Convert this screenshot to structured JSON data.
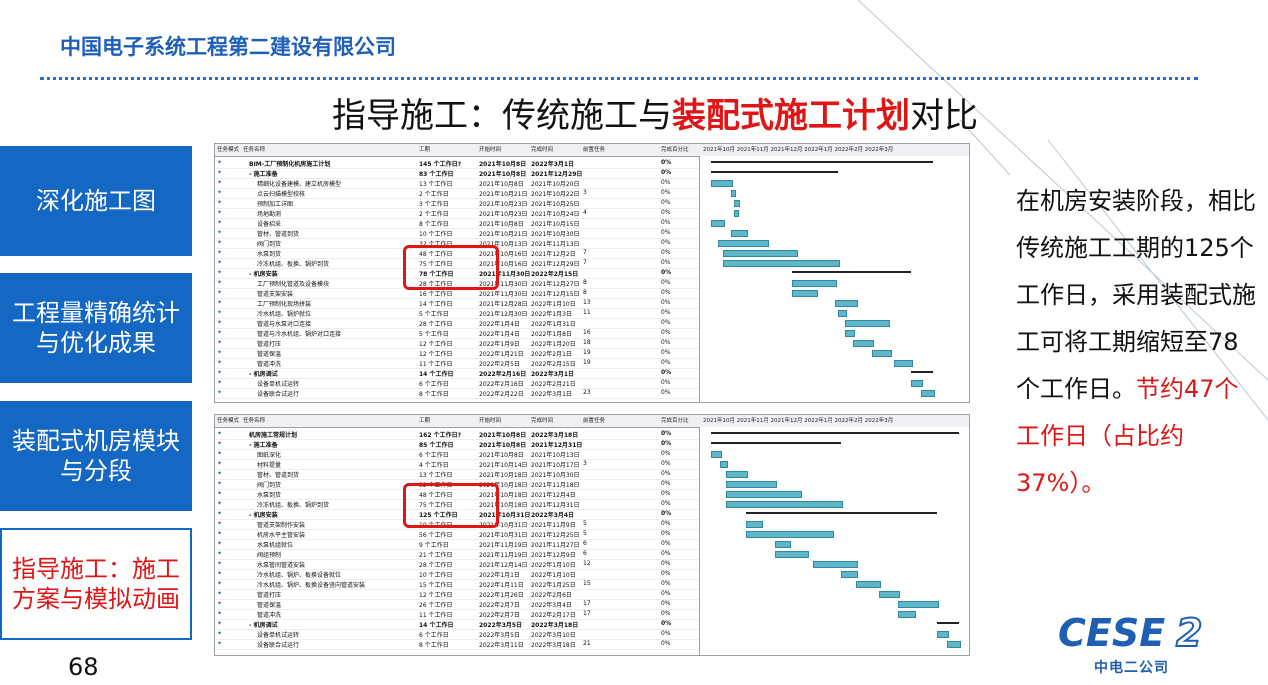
{
  "header": {
    "company": "中国电子系统工程第二建设有限公司",
    "title_prefix": "指导施工：传统施工与",
    "title_highlight": "装配式施工计划",
    "title_suffix": "对比"
  },
  "sidebar": {
    "items": [
      {
        "label": "深化施工图"
      },
      {
        "label": "工程量精确统计与优化成果"
      },
      {
        "label": "装配式机房模块与分段"
      },
      {
        "label": "指导施工：施工方案与模拟动画"
      }
    ]
  },
  "description": {
    "lead": "在机房安装阶段，相比传统施工工期的125个工作日，采用装配式施工可将工期缩短至78个工作日。",
    "saving": "节约47个工作日（占比约37%）。"
  },
  "page_number": "68",
  "logo": {
    "text": "CESE2",
    "sub": "中电二公司"
  },
  "colors": {
    "accent_blue": "#1567c4",
    "highlight_red": "#e01515",
    "bar_color": "#5fb6c9"
  },
  "gantt_columns": [
    "任务模式",
    "任务名称",
    "工期",
    "开始时间",
    "完成时间",
    "前置任务",
    "完成百分比"
  ],
  "gantt_top": {
    "timeline_label": "2021年10月 2021年11月 2021年12月 2022年1月 2022年2月 2022年3月",
    "rows": [
      {
        "name": "BIM-工厂预制化机房施工计划",
        "dur": "145 个工作日?",
        "start": "2021年10月8日",
        "end": "2022年3月1日",
        "pred": "",
        "pct": "0%",
        "sum": true
      },
      {
        "name": "- 施工准备",
        "dur": "83 个工作日",
        "start": "2021年10月8日",
        "end": "2021年12月29日",
        "pred": "",
        "pct": "0%",
        "sum": true
      },
      {
        "name": "精细化设备建模、建立机房模型",
        "dur": "13 个工作日",
        "start": "2021年10月8日",
        "end": "2021年10月20日",
        "pred": "",
        "pct": "0%"
      },
      {
        "name": "点云扫描模型校核",
        "dur": "2 个工作日",
        "start": "2021年10月21日",
        "end": "2021年10月22日",
        "pred": "3",
        "pct": "0%"
      },
      {
        "name": "预制加工详图",
        "dur": "3 个工作日",
        "start": "2021年10月23日",
        "end": "2021年10月25日",
        "pred": "",
        "pct": "0%"
      },
      {
        "name": "场地勘测",
        "dur": "2 个工作日",
        "start": "2021年10月23日",
        "end": "2021年10月24日",
        "pred": "4",
        "pct": "0%"
      },
      {
        "name": "设备招采",
        "dur": "8 个工作日",
        "start": "2021年10月8日",
        "end": "2021年10月15日",
        "pred": "",
        "pct": "0%"
      },
      {
        "name": "管材、管道到货",
        "dur": "10 个工作日",
        "start": "2021年10月21日",
        "end": "2021年10月30日",
        "pred": "",
        "pct": "0%"
      },
      {
        "name": "阀门到货",
        "dur": "32 个工作日",
        "start": "2021年10月13日",
        "end": "2021年11月13日",
        "pred": "",
        "pct": "0%"
      },
      {
        "name": "水泵到货",
        "dur": "48 个工作日",
        "start": "2021年10月16日",
        "end": "2021年12月2日",
        "pred": "7",
        "pct": "0%"
      },
      {
        "name": "冷冻机组、板换、锅炉到货",
        "dur": "75 个工作日",
        "start": "2021年10月16日",
        "end": "2021年12月29日",
        "pred": "7",
        "pct": "0%"
      },
      {
        "name": "- 机房安装",
        "dur": "78 个工作日",
        "start": "2021年11月30日",
        "end": "2022年2月15日",
        "pred": "",
        "pct": "0%",
        "sum": true
      },
      {
        "name": "工厂预制化管道及设备模块",
        "dur": "28 个工作日",
        "start": "2021年11月30日",
        "end": "2021年12月27日",
        "pred": "8",
        "pct": "0%"
      },
      {
        "name": "管道支架安装",
        "dur": "16 个工作日",
        "start": "2021年11月30日",
        "end": "2021年12月15日",
        "pred": "8",
        "pct": "0%"
      },
      {
        "name": "工厂预制化现场拼装",
        "dur": "14 个工作日",
        "start": "2021年12月28日",
        "end": "2022年1月10日",
        "pred": "13",
        "pct": "0%"
      },
      {
        "name": "冷水机组、锅炉就位",
        "dur": "5 个工作日",
        "start": "2021年12月30日",
        "end": "2022年1月3日",
        "pred": "11",
        "pct": "0%"
      },
      {
        "name": "管道与水泵对口连接",
        "dur": "28 个工作日",
        "start": "2022年1月4日",
        "end": "2022年1月31日",
        "pred": "",
        "pct": "0%"
      },
      {
        "name": "管道与冷水机组、锅炉对口连接",
        "dur": "5 个工作日",
        "start": "2022年1月4日",
        "end": "2022年1月8日",
        "pred": "16",
        "pct": "0%"
      },
      {
        "name": "管道打压",
        "dur": "12 个工作日",
        "start": "2022年1月9日",
        "end": "2022年1月20日",
        "pred": "18",
        "pct": "0%"
      },
      {
        "name": "管道保温",
        "dur": "12 个工作日",
        "start": "2022年1月21日",
        "end": "2022年2月1日",
        "pred": "19",
        "pct": "0%"
      },
      {
        "name": "管道冲洗",
        "dur": "11 个工作日",
        "start": "2022年2月5日",
        "end": "2022年2月15日",
        "pred": "19",
        "pct": "0%"
      },
      {
        "name": "- 机房调试",
        "dur": "14 个工作日",
        "start": "2022年2月16日",
        "end": "2022年3月1日",
        "pred": "",
        "pct": "0%",
        "sum": true
      },
      {
        "name": "设备单机试运转",
        "dur": "6 个工作日",
        "start": "2022年2月16日",
        "end": "2022年2月21日",
        "pred": "",
        "pct": "0%"
      },
      {
        "name": "设备联合试运行",
        "dur": "8 个工作日",
        "start": "2022年2月22日",
        "end": "2022年3月1日",
        "pred": "23",
        "pct": "0%"
      }
    ]
  },
  "gantt_bottom": {
    "timeline_label": "2021年10月 2021年11月 2021年12月 2022年1月 2022年2月 2022年3月",
    "rows": [
      {
        "name": "机房施工常规计划",
        "dur": "162 个工作日?",
        "start": "2021年10月8日",
        "end": "2022年3月18日",
        "pred": "",
        "pct": "0%",
        "sum": true
      },
      {
        "name": "- 施工准备",
        "dur": "85 个工作日",
        "start": "2021年10月8日",
        "end": "2021年12月31日",
        "pred": "",
        "pct": "0%",
        "sum": true
      },
      {
        "name": "图纸深化",
        "dur": "6 个工作日",
        "start": "2021年10月8日",
        "end": "2021年10月13日",
        "pred": "",
        "pct": "0%"
      },
      {
        "name": "材料提量",
        "dur": "4 个工作日",
        "start": "2021年10月14日",
        "end": "2021年10月17日",
        "pred": "3",
        "pct": "0%"
      },
      {
        "name": "管材、管道到货",
        "dur": "13 个工作日",
        "start": "2021年10月18日",
        "end": "2021年10月30日",
        "pred": "",
        "pct": "0%"
      },
      {
        "name": "阀门到货",
        "dur": "32 个工作日",
        "start": "2021年10月18日",
        "end": "2021年11月18日",
        "pred": "",
        "pct": "0%"
      },
      {
        "name": "水泵到货",
        "dur": "48 个工作日",
        "start": "2021年10月18日",
        "end": "2021年12月4日",
        "pred": "",
        "pct": "0%"
      },
      {
        "name": "冷冻机组、板换、锅炉到货",
        "dur": "75 个工作日",
        "start": "2021年10月18日",
        "end": "2021年12月31日",
        "pred": "",
        "pct": "0%"
      },
      {
        "name": "- 机房安装",
        "dur": "125 个工作日",
        "start": "2021年10月31日",
        "end": "2022年3月4日",
        "pred": "",
        "pct": "0%",
        "sum": true
      },
      {
        "name": "管道支架制作安装",
        "dur": "10 个工作日",
        "start": "2021年10月31日",
        "end": "2021年11月9日",
        "pred": "5",
        "pct": "0%"
      },
      {
        "name": "机房水平主管安装",
        "dur": "56 个工作日",
        "start": "2021年10月31日",
        "end": "2021年12月25日",
        "pred": "5",
        "pct": "0%"
      },
      {
        "name": "水泵机组就位",
        "dur": "9 个工作日",
        "start": "2021年11月19日",
        "end": "2021年11月27日",
        "pred": "6",
        "pct": "0%"
      },
      {
        "name": "阀组预制",
        "dur": "21 个工作日",
        "start": "2021年11月19日",
        "end": "2021年12月9日",
        "pred": "6",
        "pct": "0%"
      },
      {
        "name": "水泵管间管道安装",
        "dur": "28 个工作日",
        "start": "2021年12月14日",
        "end": "2022年1月10日",
        "pred": "12",
        "pct": "0%"
      },
      {
        "name": "冷水机组、锅炉、板换设备就位",
        "dur": "10 个工作日",
        "start": "2022年1月1日",
        "end": "2022年1月10日",
        "pred": "",
        "pct": "0%"
      },
      {
        "name": "冷水机组、锅炉、板换设备竖向管道安装",
        "dur": "15 个工作日",
        "start": "2022年1月11日",
        "end": "2022年1月25日",
        "pred": "15",
        "pct": "0%"
      },
      {
        "name": "管道打压",
        "dur": "12 个工作日",
        "start": "2022年1月26日",
        "end": "2022年2月6日",
        "pred": "",
        "pct": "0%"
      },
      {
        "name": "管道保温",
        "dur": "26 个工作日",
        "start": "2022年2月7日",
        "end": "2022年3月4日",
        "pred": "17",
        "pct": "0%"
      },
      {
        "name": "管道冲洗",
        "dur": "11 个工作日",
        "start": "2022年2月7日",
        "end": "2022年2月17日",
        "pred": "17",
        "pct": "0%"
      },
      {
        "name": "- 机房调试",
        "dur": "14 个工作日",
        "start": "2022年3月5日",
        "end": "2022年3月18日",
        "pred": "",
        "pct": "0%",
        "sum": true
      },
      {
        "name": "设备单机试运转",
        "dur": "6 个工作日",
        "start": "2022年3月5日",
        "end": "2022年3月10日",
        "pred": "",
        "pct": "0%"
      },
      {
        "name": "设备联合试运行",
        "dur": "8 个工作日",
        "start": "2022年3月11日",
        "end": "2022年3月18日",
        "pred": "21",
        "pct": "0%"
      }
    ]
  }
}
